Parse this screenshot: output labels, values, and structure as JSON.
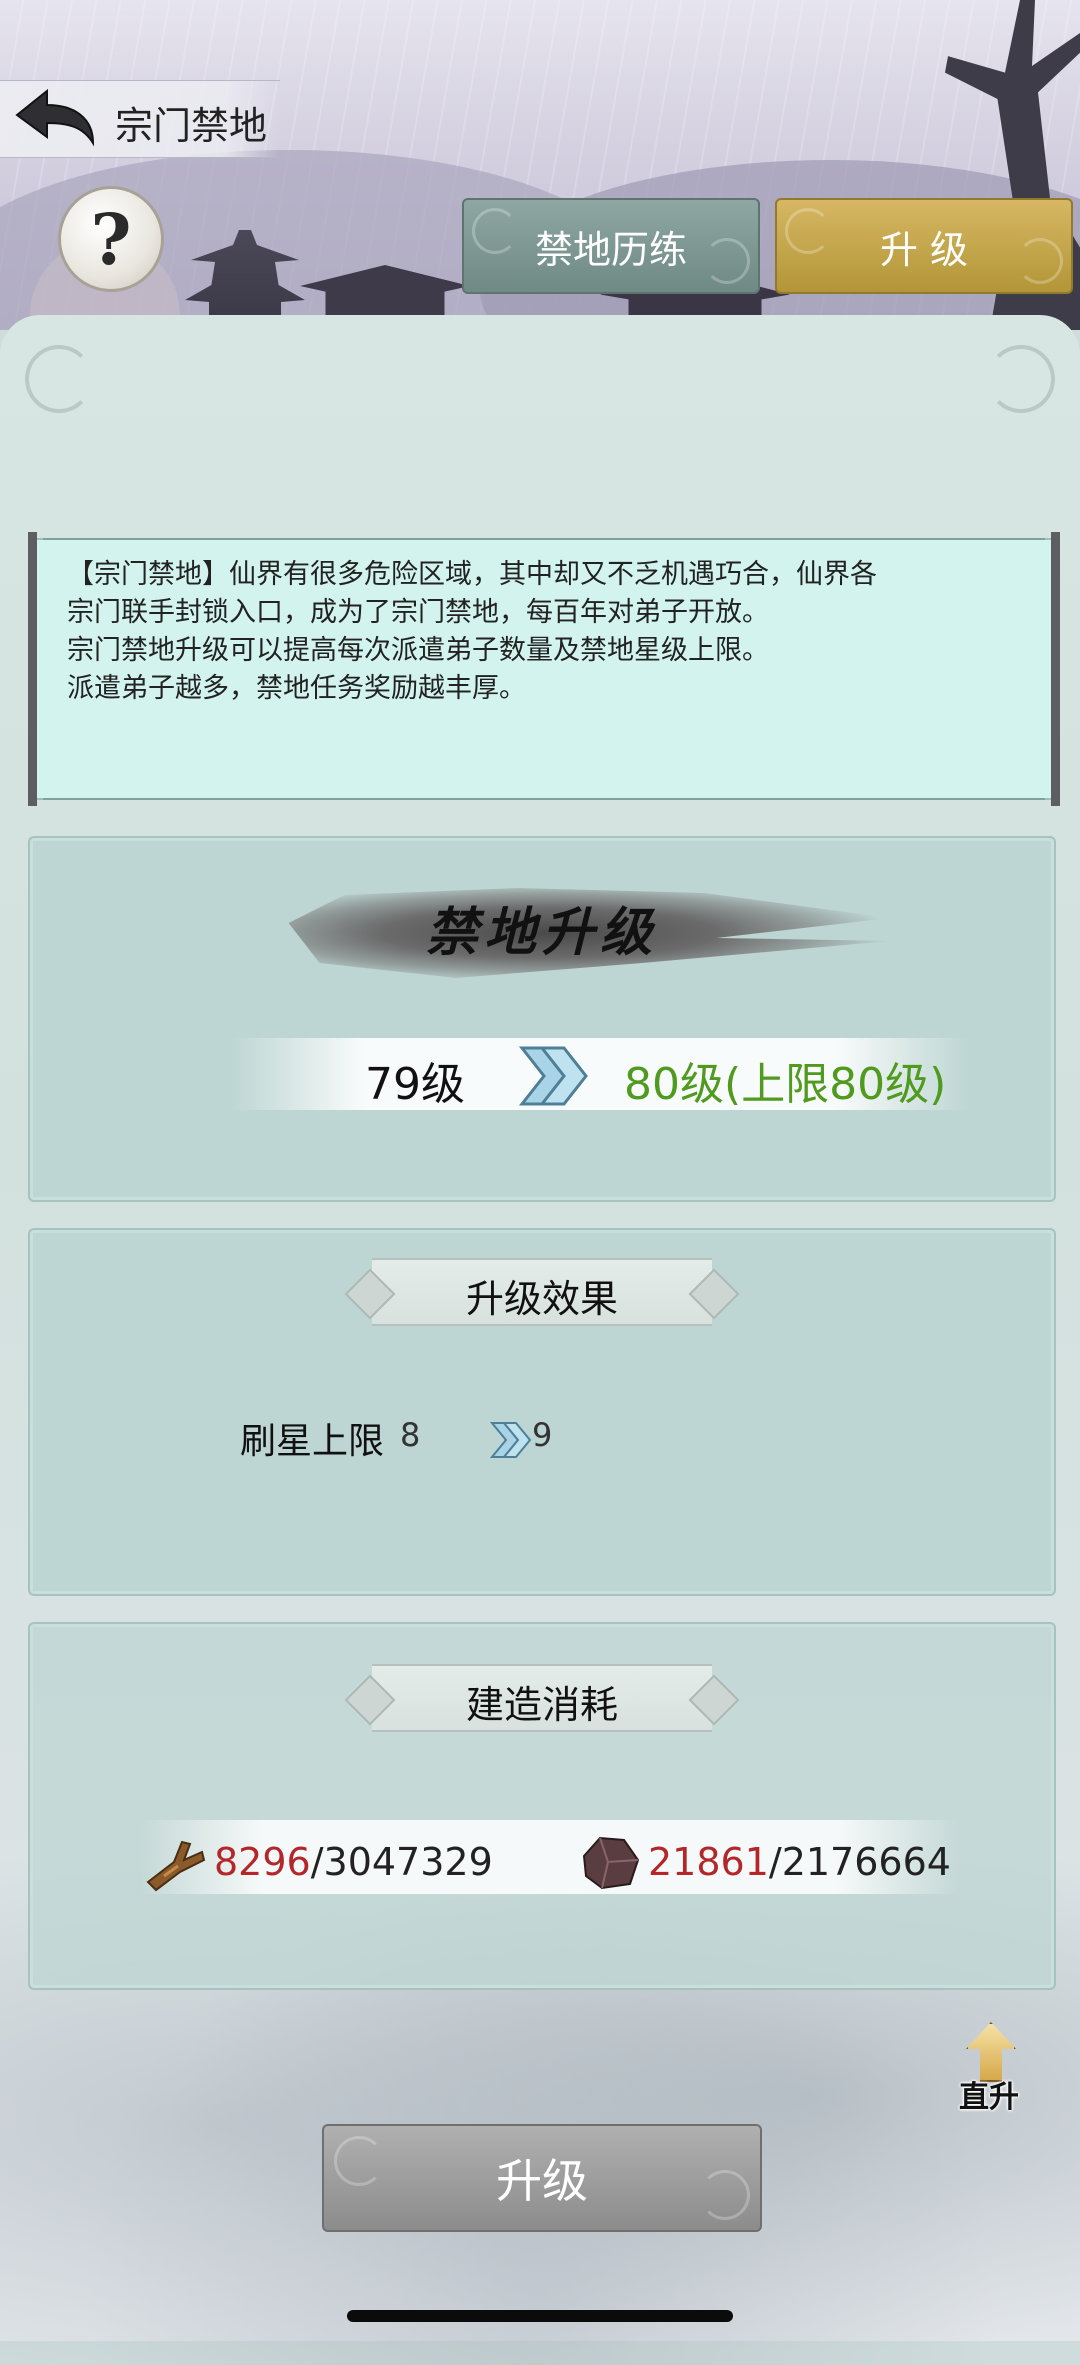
{
  "header": {
    "title": "宗门禁地"
  },
  "tabs": [
    {
      "label": "禁地历练",
      "active": false
    },
    {
      "label": "升 级",
      "active": true
    }
  ],
  "help": {
    "glyph": "?"
  },
  "description": {
    "lines": [
      "【宗门禁地】仙界有很多危险区域，其中却又不乏机遇巧合，仙界各",
      "宗门联手封锁入口，成为了宗门禁地，每百年对弟子开放。",
      "宗门禁地升级可以提高每次派遣弟子数量及禁地星级上限。",
      "派遣弟子越多，禁地任务奖励越丰厚。"
    ]
  },
  "upgrade_card": {
    "title": "禁地升级",
    "current_level": "79级",
    "next_level": "80级(上限80级)"
  },
  "effect_card": {
    "title": "升级效果",
    "effect_label": "刷星上限",
    "from": "8",
    "to": "9"
  },
  "cost_card": {
    "title": "建造消耗",
    "resources": [
      {
        "icon": "wood-icon",
        "have": "8296",
        "need": "/3047329"
      },
      {
        "icon": "ore-icon",
        "have": "21861",
        "need": "/2176664"
      }
    ]
  },
  "direct_upgrade": {
    "label": "直升"
  },
  "upgrade_button": {
    "label": "升级"
  },
  "colors": {
    "next_level": "#4f9a1f",
    "insufficient": "#b3262a",
    "active_tab": "#c7a84d",
    "inactive_tab": "#7f9894"
  }
}
